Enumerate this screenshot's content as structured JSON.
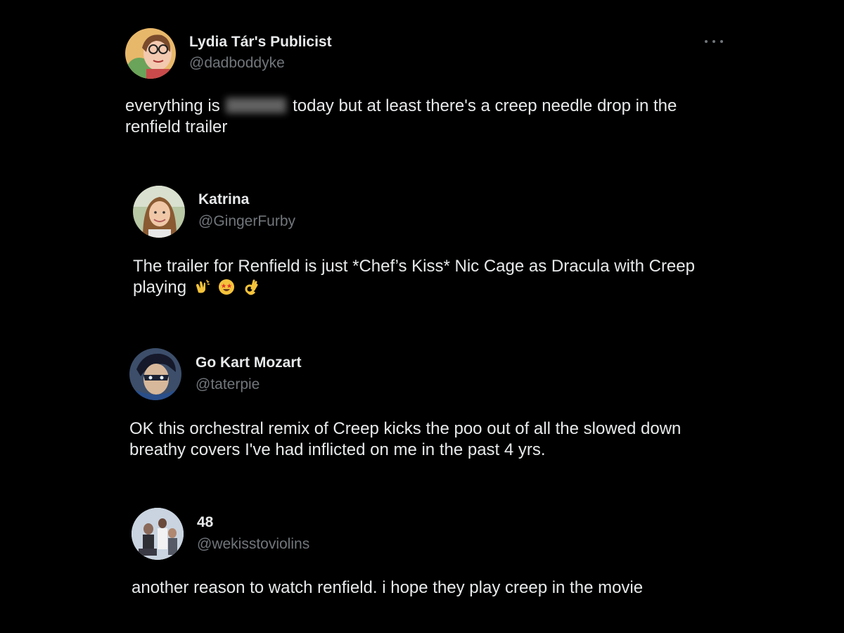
{
  "tweets": [
    {
      "name": "Lydia Tár's Publicist",
      "handle": "@dadboddyke",
      "text_before": "everything is",
      "text_after": "today but at least there's a creep needle drop in the renfield trailer"
    },
    {
      "name": "Katrina",
      "handle": "@GingerFurby",
      "text": "The trailer for Renfield is just *Chef’s Kiss* Nic Cage as Dracula with Creep playing",
      "emojis": [
        "clapping-hands-emoji",
        "star-struck-emoji",
        "ok-hand-emoji"
      ]
    },
    {
      "name": "Go Kart Mozart",
      "handle": "@taterpie",
      "text": "OK this orchestral remix of Creep kicks the poo out of all the slowed down breathy covers I've had inflicted on me in the past 4 yrs."
    },
    {
      "name": "48",
      "handle": "@wekisstoviolins",
      "text": "another reason to watch renfield. i hope they play creep in the movie"
    }
  ],
  "icons": {
    "more": "more-icon"
  },
  "colors": {
    "background": "#000000",
    "primary_text": "#e7e9ea",
    "secondary_text": "#71767b"
  }
}
